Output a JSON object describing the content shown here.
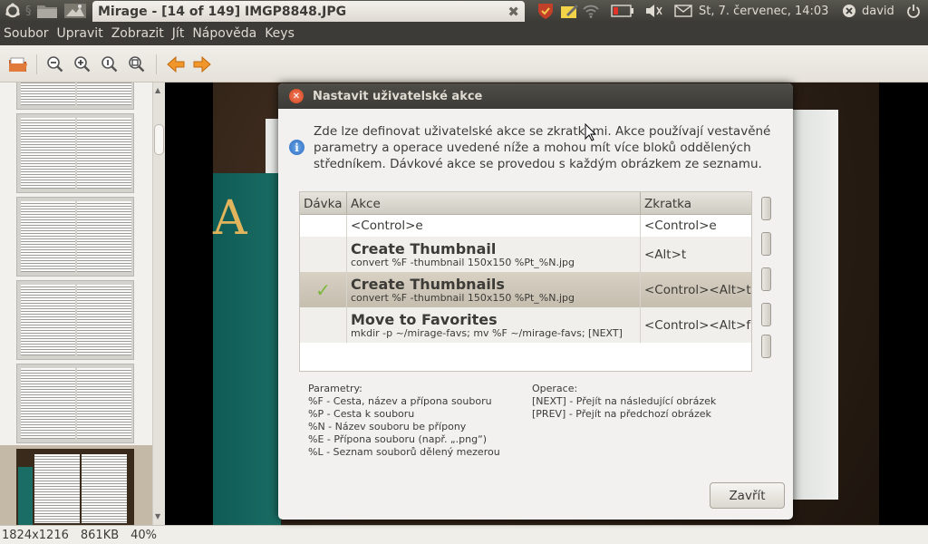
{
  "top_panel": {
    "window_title": "Mirage - [14 of 149] IMGP8848.JPG",
    "clock": "St,  7. červenec, 14:03",
    "user": "david"
  },
  "menubar": [
    "Soubor",
    "Upravit",
    "Zobrazit",
    "Jít",
    "Nápověda",
    "Keys"
  ],
  "dialog": {
    "title": "Nastavit uživatelské akce",
    "info_text": "Zde lze definovat uživatelské akce se zkratkami. Akce používají vestavěné parametry a operace uvedené níže a mohou mít více bloků oddělených středníkem. Dávkové akce se provedou s každým obrázkem ze seznamu.",
    "columns": [
      "Dávka",
      "Akce",
      "Zkratka"
    ],
    "rows": [
      {
        "batch": false,
        "name": "<Control>e",
        "command": "",
        "shortcut": "<Control>e"
      },
      {
        "batch": false,
        "name": "Create Thumbnail",
        "command": "convert %F -thumbnail 150x150 %Pt_%N.jpg",
        "shortcut": "<Alt>t"
      },
      {
        "batch": true,
        "name": "Create Thumbnails",
        "command": "convert %F -thumbnail 150x150 %Pt_%N.jpg",
        "shortcut": "<Control><Alt>t"
      },
      {
        "batch": false,
        "name": "Move to Favorites",
        "command": "mkdir -p ~/mirage-favs; mv %F ~/mirage-favs; [NEXT]",
        "shortcut": "<Control><Alt>f"
      }
    ],
    "params_title": "Parametry:",
    "params": [
      "%F - Cesta, název a přípona souboru",
      "%P - Cesta k souboru",
      "%N - Název souboru be přípony",
      "%E - Přípona souboru (např. „.png“)",
      "%L - Seznam souborů dělený mezerou"
    ],
    "ops_title": "Operace:",
    "ops": [
      "[NEXT] - Přejít na následující obrázek",
      "[PREV] - Přejít na předchozí obrázek"
    ],
    "close_label": "Zavřít"
  },
  "statusbar": {
    "dimensions": "1824x1216",
    "filesize": "861KB",
    "zoom": "40%"
  },
  "book_letter": "A"
}
